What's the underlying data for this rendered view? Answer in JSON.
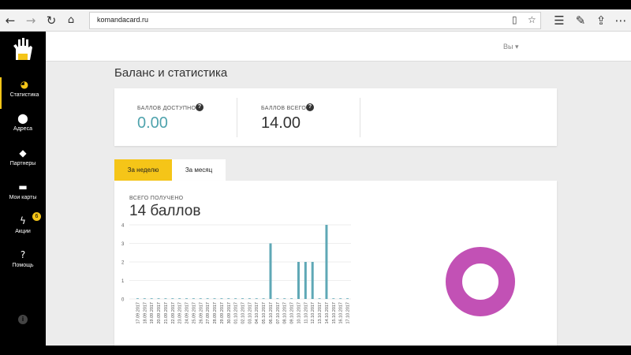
{
  "browser": {
    "url": "komandacard.ru",
    "back_icon": "arrow-left",
    "forward_icon": "arrow-right",
    "refresh_icon": "refresh",
    "home_icon": "home"
  },
  "sidebar": {
    "items": [
      {
        "label": "Статистика",
        "icon": "pie-chart-icon"
      },
      {
        "label": "Адреса",
        "icon": "pin-icon"
      },
      {
        "label": "Партнеры",
        "icon": "tag-icon"
      },
      {
        "label": "Мои карты",
        "icon": "card-icon"
      },
      {
        "label": "Акции",
        "icon": "lightning-icon",
        "badge": "6"
      },
      {
        "label": "Помощь",
        "icon": "question-icon"
      }
    ],
    "accent": "#f5c518"
  },
  "header": {
    "user_label": "Вы ▾"
  },
  "main": {
    "title": "Баланс и статистика",
    "balance": {
      "available_label": "БАЛЛОВ ДОСТУПНО",
      "available_value": "0.00",
      "total_label": "БАЛЛОВ ВСЕГО",
      "total_value": "14.00"
    },
    "tabs": [
      {
        "label": "За неделю",
        "active": true
      },
      {
        "label": "За месяц",
        "active": false
      }
    ],
    "received_label": "ВСЕГО ПОЛУЧЕНО",
    "received_value": "14 баллов"
  },
  "colors": {
    "bar": "#5fa8b6",
    "donut": "#c251b5",
    "available": "#4fa3ad"
  },
  "chart_data": {
    "type": "bar",
    "categories": [
      "17.09.2017",
      "18.09.2017",
      "19.09.2017",
      "20.09.2017",
      "21.09.2017",
      "22.09.2017",
      "23.09.2017",
      "24.09.2017",
      "25.09.2017",
      "26.09.2017",
      "27.09.2017",
      "28.09.2017",
      "29.09.2017",
      "30.09.2017",
      "01.10.2017",
      "02.10.2017",
      "03.10.2017",
      "04.10.2017",
      "05.10.2017",
      "06.10.2017",
      "07.10.2017",
      "08.10.2017",
      "09.10.2017",
      "10.10.2017",
      "11.10.2017",
      "12.10.2017",
      "13.10.2017",
      "14.10.2017",
      "15.10.2017",
      "16.10.2017",
      "17.10.2017"
    ],
    "values": [
      0,
      0,
      0,
      0,
      0,
      0,
      0,
      0,
      0,
      0,
      0,
      0,
      0,
      0,
      0,
      0,
      0,
      0,
      0,
      3,
      0,
      0,
      0,
      2,
      2,
      2,
      0,
      4,
      0,
      0,
      0
    ],
    "yticks": [
      "4",
      "3",
      "2",
      "1",
      "0"
    ],
    "ylim": [
      0,
      4
    ],
    "grid": true
  }
}
